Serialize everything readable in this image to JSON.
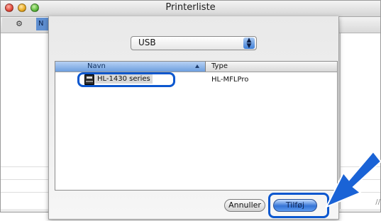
{
  "window": {
    "title": "Printerliste"
  },
  "toolbar": {
    "gear_glyph": "⚙",
    "cut_text": "N"
  },
  "sheet": {
    "connection_popup": {
      "value": "USB"
    },
    "list": {
      "columns": [
        "Navn",
        "Type"
      ],
      "rows": [
        {
          "name": "HL-1430 series",
          "type": "HL-MFLPro"
        }
      ]
    },
    "buttons": {
      "cancel": "Annuller",
      "add": "Tilføj"
    }
  },
  "colors": {
    "highlight": "#0b57cf",
    "arrow": "#1a63d6"
  }
}
